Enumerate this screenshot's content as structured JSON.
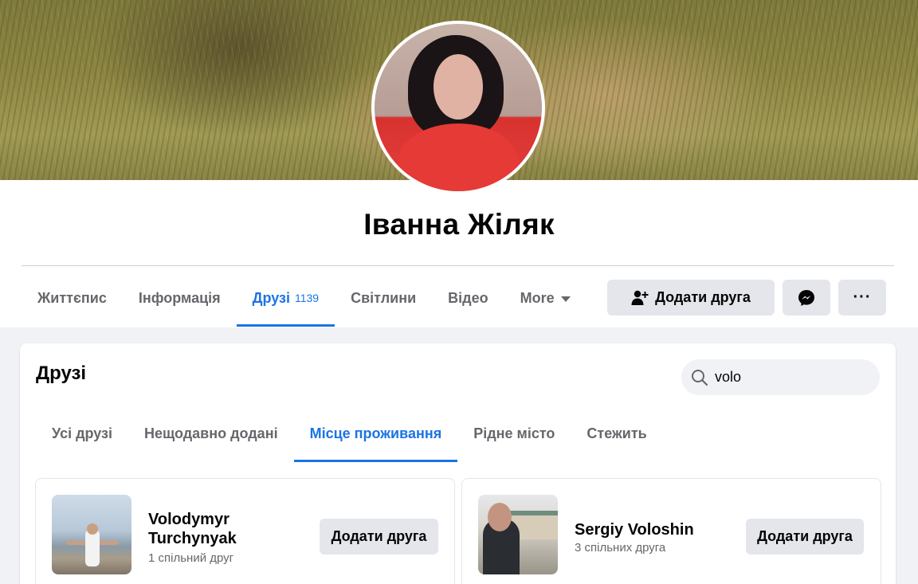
{
  "profile": {
    "name": "Іванна Жіляк"
  },
  "nav": {
    "tabs": [
      {
        "label": "Життєпис"
      },
      {
        "label": "Інформація"
      },
      {
        "label": "Друзі",
        "count": "1139"
      },
      {
        "label": "Світлини"
      },
      {
        "label": "Відео"
      },
      {
        "label": "More"
      }
    ],
    "active_tab": "Друзі"
  },
  "actions": {
    "add_friend_label": "Додати друга",
    "messenger_icon": "messenger-icon",
    "more_label": "···"
  },
  "friends_section": {
    "title": "Друзі",
    "search": {
      "value": "volo"
    },
    "subtabs": [
      {
        "label": "Усі друзі"
      },
      {
        "label": "Нещодавно додані"
      },
      {
        "label": "Місце проживання"
      },
      {
        "label": "Рідне місто"
      },
      {
        "label": "Стежить"
      }
    ],
    "active_subtab": "Місце проживання",
    "results": [
      {
        "name": "Volodymyr Turchynyak",
        "mutual": "1 спільний друг",
        "button": "Додати друга"
      },
      {
        "name": "Sergiy Voloshin",
        "mutual": "3 спільних друга",
        "button": "Додати друга"
      }
    ]
  },
  "colors": {
    "accent": "#1b74e4",
    "button_bg": "#e4e6eb",
    "page_bg": "#f0f2f5"
  }
}
